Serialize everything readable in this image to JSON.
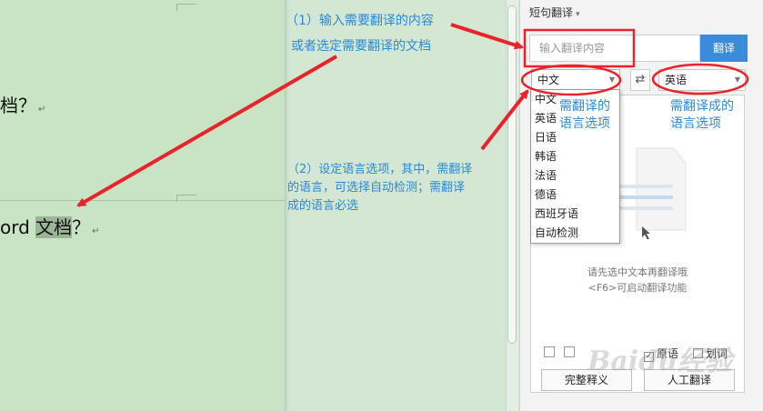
{
  "document": {
    "line1_text": "档？",
    "line2_prefix": "ord ",
    "line2_highlight": "文档",
    "line2_suffix": "？",
    "paragraph_mark": "↵"
  },
  "annotations": {
    "step1_line1": "（1）输入需要翻译的内容",
    "step1_line2": "或者选定需要翻译的文档",
    "step2_line1": "（2）设定语言选项，其中，需翻译",
    "step2_line2": "的语言，可选择自动检测；需翻译",
    "step2_line3": "成的语言必选",
    "source_note_line1": "需翻译的",
    "source_note_line2": "语言选项",
    "target_note_line1": "需翻译成的",
    "target_note_line2": "语言选项",
    "color": "#2d89d6",
    "arrow_color": "#e8232a"
  },
  "panel": {
    "title": "短句翻译",
    "input_placeholder": "输入翻译内容",
    "translate_button": "翻译",
    "source_language": "中文",
    "target_language": "英语",
    "swap_icon": "⇄",
    "language_options": [
      "中文",
      "英语",
      "日语",
      "韩语",
      "法语",
      "德语",
      "西班牙语",
      "自动检测"
    ],
    "hint_line1": "请先选中文本再翻译哦",
    "hint_line2": "<F6>可启动翻译功能",
    "check_source": "原语",
    "check_word": "划词",
    "full_paraphrase_button": "完整释义",
    "human_translate_button": "人工翻译"
  },
  "watermark": "Baidu经验"
}
